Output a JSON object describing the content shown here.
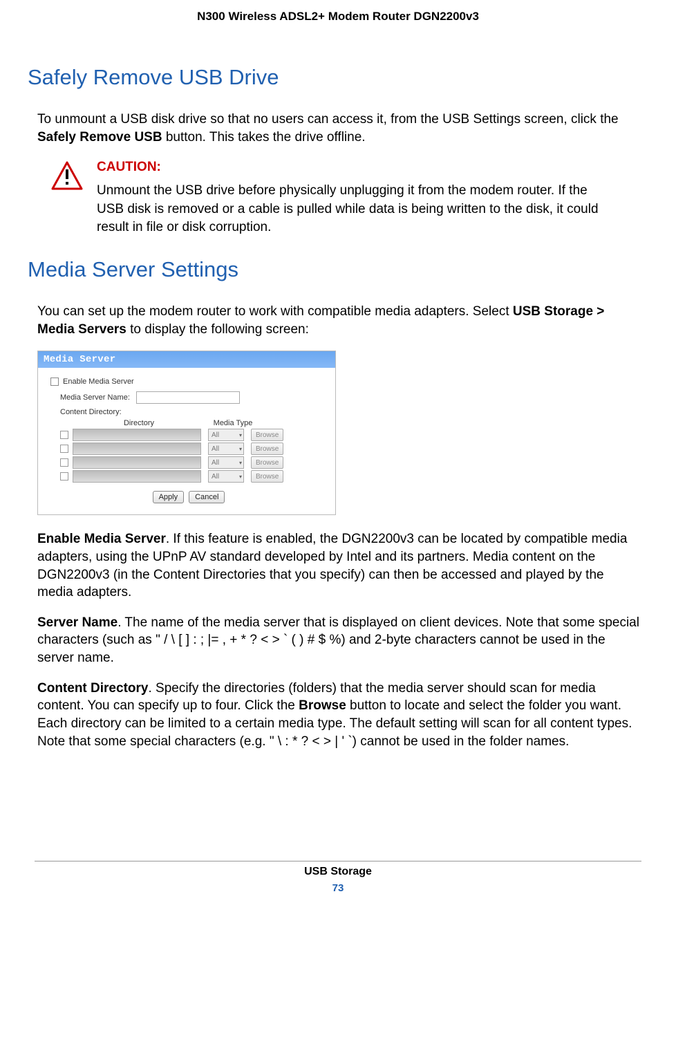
{
  "header": {
    "doc_title": "N300 Wireless ADSL2+ Modem Router DGN2200v3"
  },
  "sections": {
    "safely_remove": {
      "heading": "Safely Remove USB Drive",
      "intro_pre": "To unmount a USB disk drive so that no users can access it, from the USB Settings screen, click the ",
      "intro_bold": "Safely Remove USB",
      "intro_post": " button. This takes the drive offline."
    },
    "caution": {
      "label": "CAUTION:",
      "text": "Unmount the USB drive before physically unplugging it from the modem router. If the USB disk is removed or a cable is pulled while data is being written to the disk, it could result in file or disk corruption."
    },
    "media_server": {
      "heading": "Media Server Settings",
      "intro_pre": "You can set up the modem router to work with compatible media adapters. Select ",
      "intro_bold": "USB Storage > Media Servers",
      "intro_post": " to display the following screen:"
    }
  },
  "screenshot": {
    "title": "Media Server",
    "enable_label": "Enable Media Server",
    "name_label": "Media Server Name:",
    "content_dir_label": "Content Directory:",
    "col_directory": "Directory",
    "col_media_type": "Media Type",
    "select_value": "All",
    "browse_btn": "Browse",
    "apply_btn": "Apply",
    "cancel_btn": "Cancel"
  },
  "descriptions": {
    "enable_bold": "Enable Media Server",
    "enable_text": ". If this feature is enabled, the DGN2200v3 can be located by compatible media adapters, using the UPnP AV standard developed by Intel and its partners. Media content on the DGN2200v3 (in the Content Directories that you specify) can then be accessed and played by the media adapters.",
    "server_bold": "Server Name",
    "server_text": ". The name of the media server that is displayed on client devices. Note that some special characters (such as \" / \\ [ ] : ; |= , + * ? < > ` ( ) # $ %) and 2-byte characters cannot be used in the server name.",
    "content_bold": "Content Directory",
    "content_pre": ". Specify the directories (folders) that the media server should scan for media content. You can specify up to four. Click the ",
    "content_browse_bold": "Browse",
    "content_post": " button to locate and select the folder you want. Each directory can be limited to a certain media type. The default setting will scan for all content types. Note that some special characters (e.g. \" \\ : * ? < > | ' `) cannot be used in the folder names."
  },
  "footer": {
    "section": "USB Storage",
    "page": "73"
  }
}
